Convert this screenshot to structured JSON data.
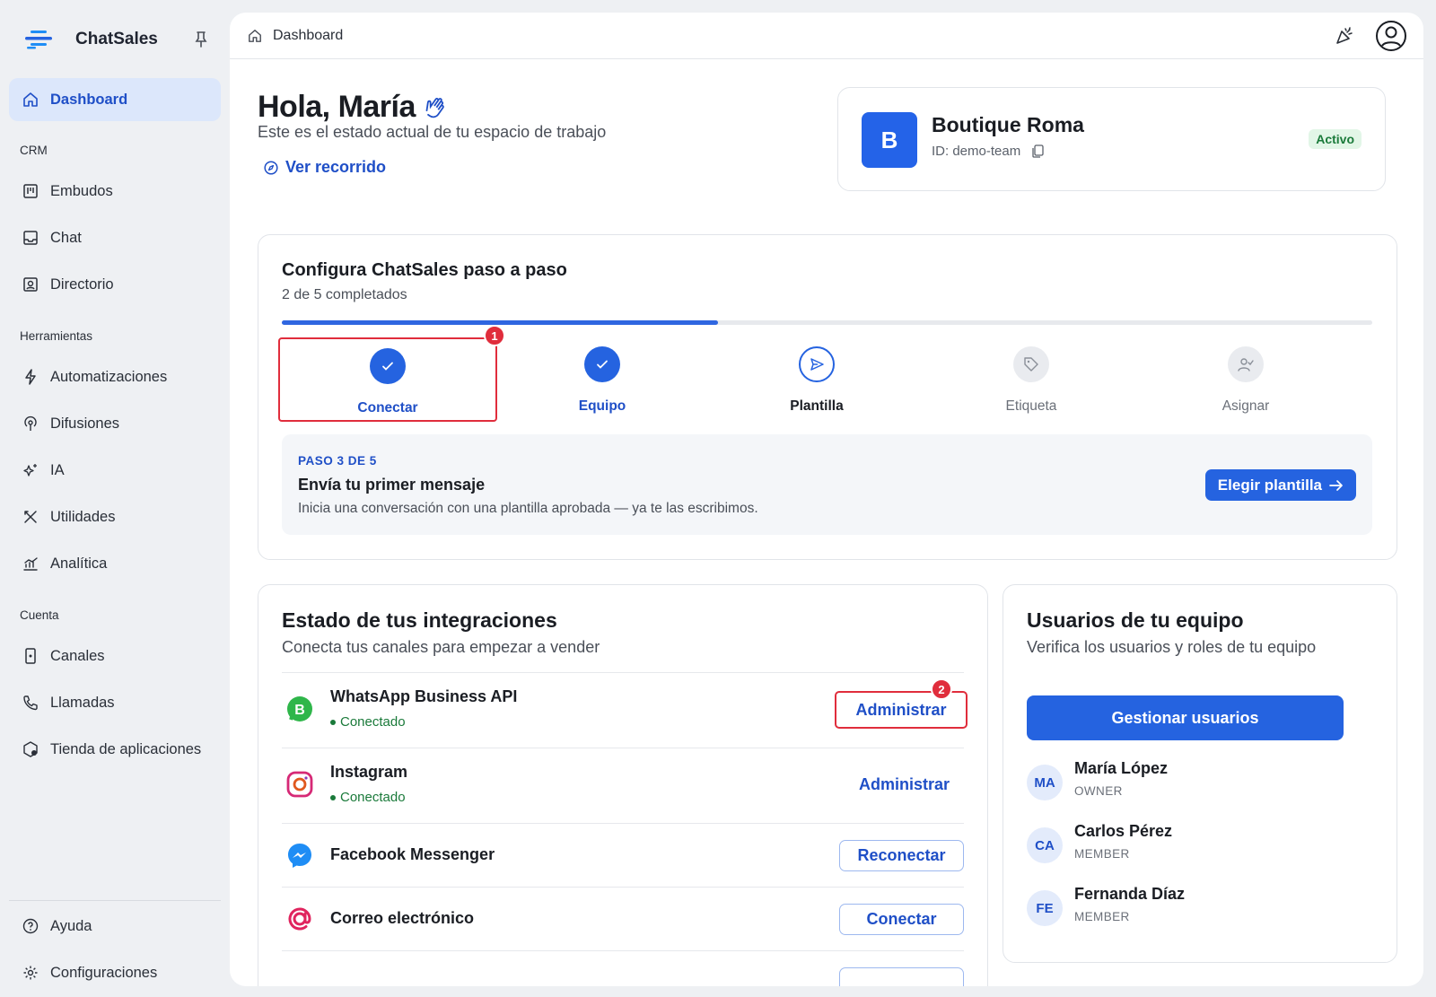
{
  "sidebar": {
    "brand": "ChatSales",
    "dashboard": "Dashboard",
    "sections": {
      "crm": "CRM",
      "tools": "Herramientas",
      "account": "Cuenta"
    },
    "crm_items": [
      "Embudos",
      "Chat",
      "Directorio"
    ],
    "tool_items": [
      "Automatizaciones",
      "Difusiones",
      "IA",
      "Utilidades",
      "Analítica"
    ],
    "account_items": [
      "Canales",
      "Llamadas",
      "Tienda de aplicaciones"
    ],
    "footer_items": [
      "Ayuda",
      "Configuraciones"
    ]
  },
  "topbar": {
    "breadcrumb": "Dashboard"
  },
  "greeting": {
    "title": "Hola, María",
    "subtitle": "Este es el estado actual de tu espacio de trabajo",
    "tour_link": "Ver recorrido"
  },
  "workspace": {
    "initial": "B",
    "name": "Boutique Roma",
    "id_label": "ID: demo-team",
    "status": "Activo"
  },
  "setup": {
    "title": "Configura ChatSales paso a paso",
    "subtitle": "2 de 5 completados",
    "progress": 0.4,
    "steps": [
      {
        "label": "Conectar",
        "state": "done"
      },
      {
        "label": "Equipo",
        "state": "done"
      },
      {
        "label": "Plantilla",
        "state": "current"
      },
      {
        "label": "Etiqueta",
        "state": "todo"
      },
      {
        "label": "Asignar",
        "state": "todo"
      }
    ],
    "marker_1": "1",
    "panel": {
      "kicker": "PASO 3 DE 5",
      "heading": "Envía tu primer mensaje",
      "description": "Inicia una conversación con una plantilla aprobada — ya te las escribimos.",
      "button": "Elegir plantilla"
    }
  },
  "integrations": {
    "title": "Estado de tus integraciones",
    "subtitle": "Conecta tus canales para empezar a vender",
    "marker_2": "2",
    "rows": [
      {
        "name": "WhatsApp Business API",
        "status": "Conectado",
        "action": "Administrar"
      },
      {
        "name": "Instagram",
        "status": "Conectado",
        "action": "Administrar"
      },
      {
        "name": "Facebook Messenger",
        "action": "Reconectar"
      },
      {
        "name": "Correo electrónico",
        "action": "Conectar"
      }
    ],
    "colors": {
      "whatsapp": "#2fb64a",
      "instagram": "#d62976",
      "messenger": "#1f8df5",
      "email": "#e0245e"
    }
  },
  "team": {
    "title": "Usuarios de tu equipo",
    "subtitle": "Verifica los usuarios y roles de tu equipo",
    "button": "Gestionar usuarios",
    "users": [
      {
        "initials": "MA",
        "name": "María López",
        "role": "OWNER"
      },
      {
        "initials": "CA",
        "name": "Carlos Pérez",
        "role": "MEMBER"
      },
      {
        "initials": "FE",
        "name": "Fernanda Díaz",
        "role": "MEMBER"
      }
    ]
  },
  "colors": {
    "accent": "#2563e0",
    "highlight": "#e02d3c",
    "success": "#1a7a3a"
  }
}
